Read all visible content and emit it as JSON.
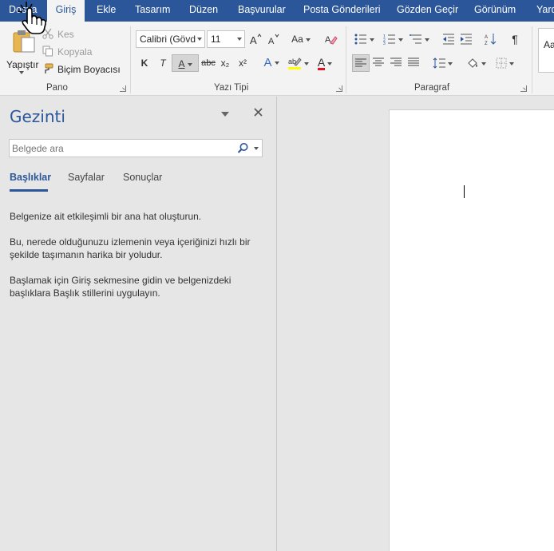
{
  "tabs": [
    {
      "label": "Dosya"
    },
    {
      "label": "Giriş"
    },
    {
      "label": "Ekle"
    },
    {
      "label": "Tasarım"
    },
    {
      "label": "Düzen"
    },
    {
      "label": "Başvurular"
    },
    {
      "label": "Posta Gönderileri"
    },
    {
      "label": "Gözden Geçir"
    },
    {
      "label": "Görünüm"
    },
    {
      "label": "Yard"
    }
  ],
  "ribbon": {
    "clipboard": {
      "paste_label": "Yapıştır",
      "cut_label": "Kes",
      "copy_label": "Kopyala",
      "format_painter_label": "Biçim Boyacısı",
      "group_label": "Pano"
    },
    "font": {
      "font_name": "Calibri (Gövd",
      "font_size": "11",
      "case_label": "Aa",
      "bold_label": "K",
      "italic_label": "T",
      "underline_label": "A",
      "strike_label": "abc",
      "subscript_label": "x₂",
      "superscript_label": "x²",
      "text_effects_label": "A",
      "font_color_label": "A",
      "group_label": "Yazı Tipi",
      "highlight_color": "#ffff00",
      "font_color": "#e81123"
    },
    "paragraph": {
      "pilcrow": "¶",
      "group_label": "Paragraf"
    },
    "styles": {
      "sample_label": "Aa"
    }
  },
  "nav": {
    "title": "Gezinti",
    "search_placeholder": "Belgede ara",
    "tabs": [
      {
        "label": "Başlıklar"
      },
      {
        "label": "Sayfalar"
      },
      {
        "label": "Sonuçlar"
      }
    ],
    "paragraphs": [
      "Belgenize ait etkileşimli bir ana hat oluşturun.",
      "Bu, nerede olduğunuzu izlemenin veya içeriğinizi hızlı bir şekilde taşımanın harika bir yoludur.",
      "Başlamak için Giriş sekmesine gidin ve belgenizdeki başlıklara Başlık stillerini uygulayın."
    ]
  },
  "colors": {
    "brand": "#2b579a",
    "background": "#e6e6e6",
    "ribbon": "#f3f3f3"
  }
}
